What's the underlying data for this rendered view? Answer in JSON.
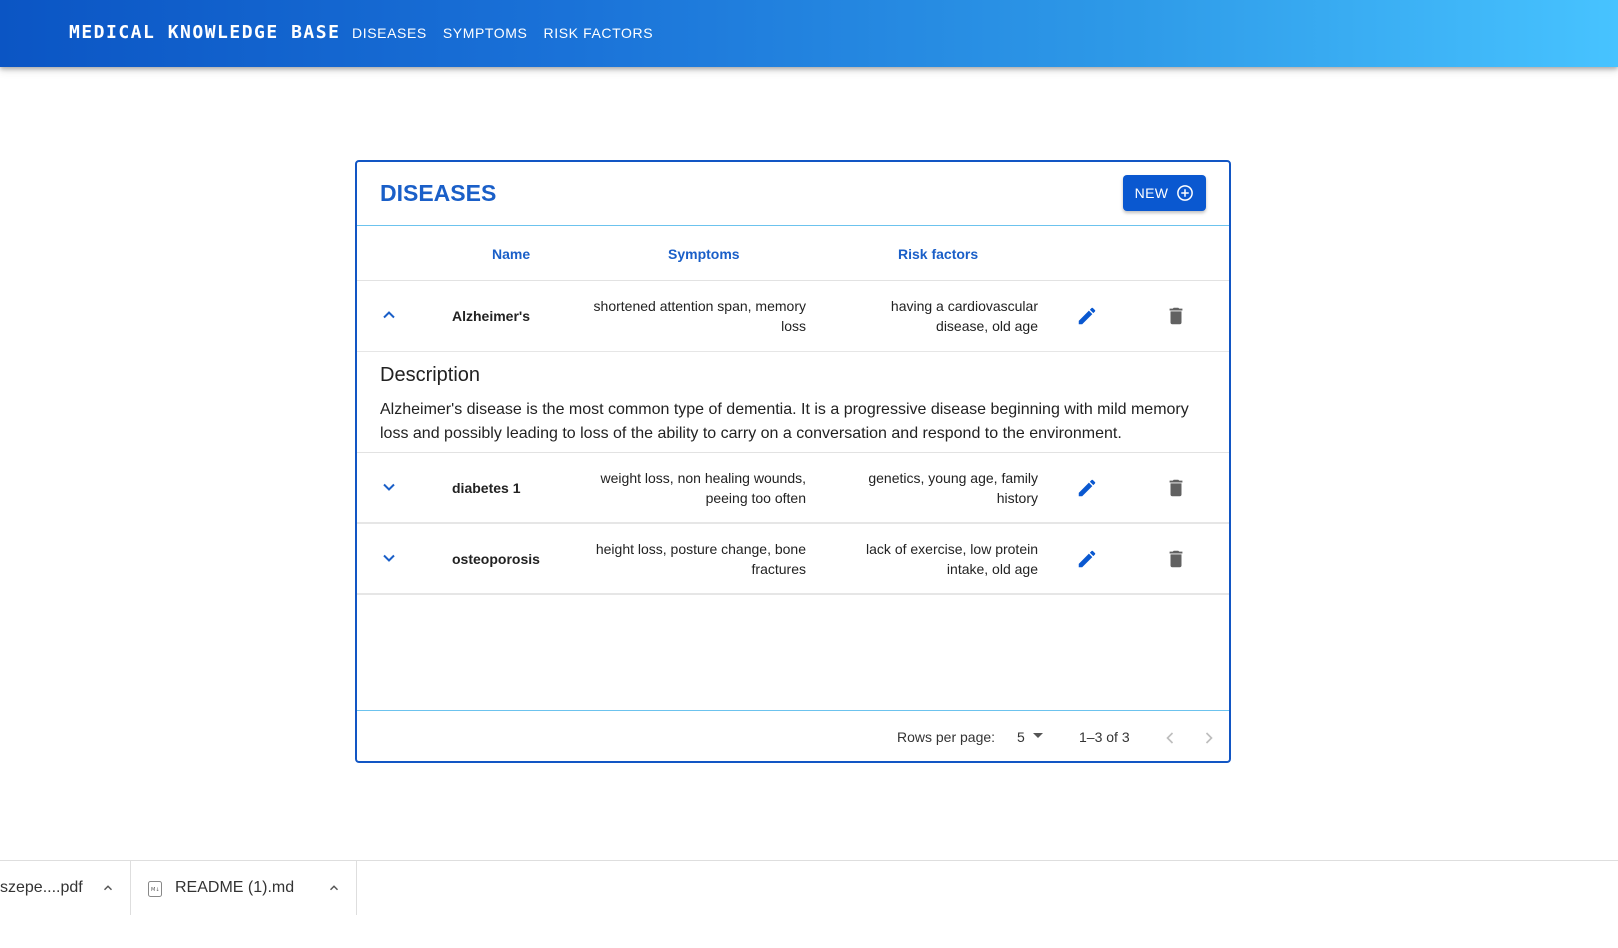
{
  "appbar": {
    "brand": "MEDICAL KNOWLEDGE BASE",
    "nav": [
      "DISEASES",
      "SYMPTOMS",
      "RISK FACTORS"
    ]
  },
  "card": {
    "title": "DISEASES",
    "new_label": "NEW",
    "columns": {
      "name": "Name",
      "symptoms": "Symptoms",
      "risk": "Risk factors"
    },
    "rows": [
      {
        "name": "Alzheimer's",
        "symptoms": "shortened attention span, memory loss",
        "risk": "having a cardiovascular disease, old age",
        "expanded": true
      },
      {
        "name": "diabetes 1",
        "symptoms": "weight loss, non healing wounds, peeing too often",
        "risk": "genetics, young age, family history",
        "expanded": false
      },
      {
        "name": "osteoporosis",
        "symptoms": "height loss, posture change, bone fractures",
        "risk": "lack of exercise, low protein intake, old age",
        "expanded": false
      }
    ],
    "description": {
      "title": "Description",
      "text": "Alzheimer's disease is the most common type of dementia. It is a progressive disease beginning with mild memory loss and possibly leading to loss of the ability to carry on a conversation and respond to the environment."
    },
    "pagination": {
      "rows_per_page_label": "Rows per page:",
      "rows_per_page": "5",
      "range": "1–3 of 3"
    }
  },
  "downloads": [
    {
      "name": "szepe....pdf"
    },
    {
      "name": "README (1).md"
    }
  ],
  "colors": {
    "accent": "#1a5fc8",
    "button": "#0a58d0",
    "border": "#1256c4",
    "icon_gray": "#616161"
  }
}
